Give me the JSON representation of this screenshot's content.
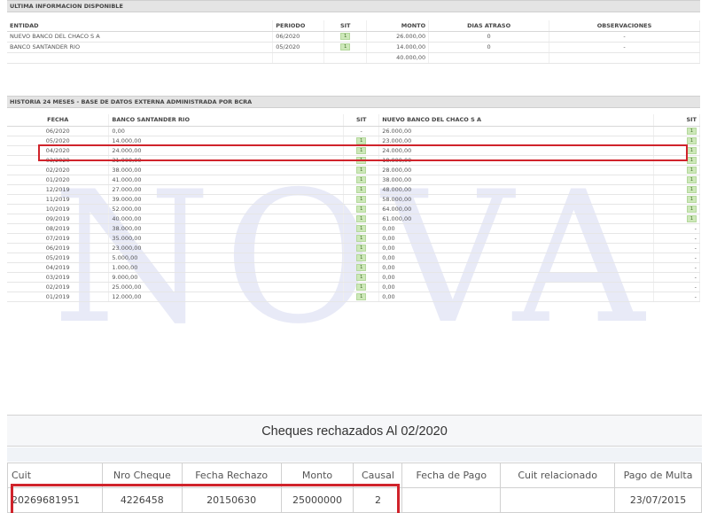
{
  "watermark": "NOVA",
  "ultima": {
    "title": "ULTIMA INFORMACION DISPONIBLE",
    "headers": [
      "ENTIDAD",
      "PERIODO",
      "SIT",
      "MONTO",
      "DIAS ATRASO",
      "OBSERVACIONES"
    ],
    "rows": [
      {
        "entidad": "NUEVO BANCO DEL CHACO S A",
        "periodo": "06/2020",
        "sit": "1",
        "monto": "26.000,00",
        "dias": "0",
        "obs": "-"
      },
      {
        "entidad": "BANCO SANTANDER RIO",
        "periodo": "05/2020",
        "sit": "1",
        "monto": "14.000,00",
        "dias": "0",
        "obs": "-"
      }
    ],
    "total": "40.000,00"
  },
  "historia": {
    "title": "HISTORIA 24 MESES - BASE DE DATOS EXTERNA ADMINISTRADA POR BCRA",
    "headers": [
      "FECHA",
      "BANCO SANTANDER RIO",
      "SIT",
      "NUEVO BANCO DEL CHACO S A",
      "SIT"
    ],
    "rows": [
      {
        "fecha": "06/2020",
        "m1": "0,00",
        "s1": "-",
        "m2": "26.000,00",
        "s2": "1"
      },
      {
        "fecha": "05/2020",
        "m1": "14.000,00",
        "s1": "1",
        "m2": "23.000,00",
        "s2": "1"
      },
      {
        "fecha": "04/2020",
        "m1": "24.000,00",
        "s1": "1",
        "m2": "24.000,00",
        "s2": "1"
      },
      {
        "fecha": "03/2020",
        "m1": "31.000,00",
        "s1": "1",
        "m2": "18.000,00",
        "s2": "1"
      },
      {
        "fecha": "02/2020",
        "m1": "38.000,00",
        "s1": "1",
        "m2": "28.000,00",
        "s2": "1"
      },
      {
        "fecha": "01/2020",
        "m1": "41.000,00",
        "s1": "1",
        "m2": "38.000,00",
        "s2": "1"
      },
      {
        "fecha": "12/2019",
        "m1": "27.000,00",
        "s1": "1",
        "m2": "48.000,00",
        "s2": "1"
      },
      {
        "fecha": "11/2019",
        "m1": "39.000,00",
        "s1": "1",
        "m2": "58.000,00",
        "s2": "1"
      },
      {
        "fecha": "10/2019",
        "m1": "52.000,00",
        "s1": "1",
        "m2": "64.000,00",
        "s2": "1"
      },
      {
        "fecha": "09/2019",
        "m1": "40.000,00",
        "s1": "1",
        "m2": "61.000,00",
        "s2": "1"
      },
      {
        "fecha": "08/2019",
        "m1": "38.000,00",
        "s1": "1",
        "m2": "0,00",
        "s2": "-"
      },
      {
        "fecha": "07/2019",
        "m1": "35.000,00",
        "s1": "1",
        "m2": "0,00",
        "s2": "-"
      },
      {
        "fecha": "06/2019",
        "m1": "23.000,00",
        "s1": "1",
        "m2": "0,00",
        "s2": "-"
      },
      {
        "fecha": "05/2019",
        "m1": "5.000,00",
        "s1": "1",
        "m2": "0,00",
        "s2": "-"
      },
      {
        "fecha": "04/2019",
        "m1": "1.000,00",
        "s1": "1",
        "m2": "0,00",
        "s2": "-"
      },
      {
        "fecha": "03/2019",
        "m1": "9.000,00",
        "s1": "1",
        "m2": "0,00",
        "s2": "-"
      },
      {
        "fecha": "02/2019",
        "m1": "25.000,00",
        "s1": "1",
        "m2": "0,00",
        "s2": "-"
      },
      {
        "fecha": "01/2019",
        "m1": "12.000,00",
        "s1": "1",
        "m2": "0,00",
        "s2": "-"
      }
    ]
  },
  "cheques": {
    "title": "Cheques rechazados Al 02/2020",
    "headers": [
      "Cuit",
      "Nro Cheque",
      "Fecha Rechazo",
      "Monto",
      "Causal",
      "Fecha de Pago",
      "Cuit relacionado",
      "Pago de Multa"
    ],
    "rows": [
      {
        "cuit": "20269681951",
        "nro": "4226458",
        "fecha": "20150630",
        "monto": "25000000",
        "causal": "2",
        "fecha_pago": "",
        "cuit_rel": "",
        "multa": "23/07/2015"
      }
    ]
  },
  "colors": {
    "highlight": "#d0232b",
    "sit_badge": "#cde8b9"
  }
}
